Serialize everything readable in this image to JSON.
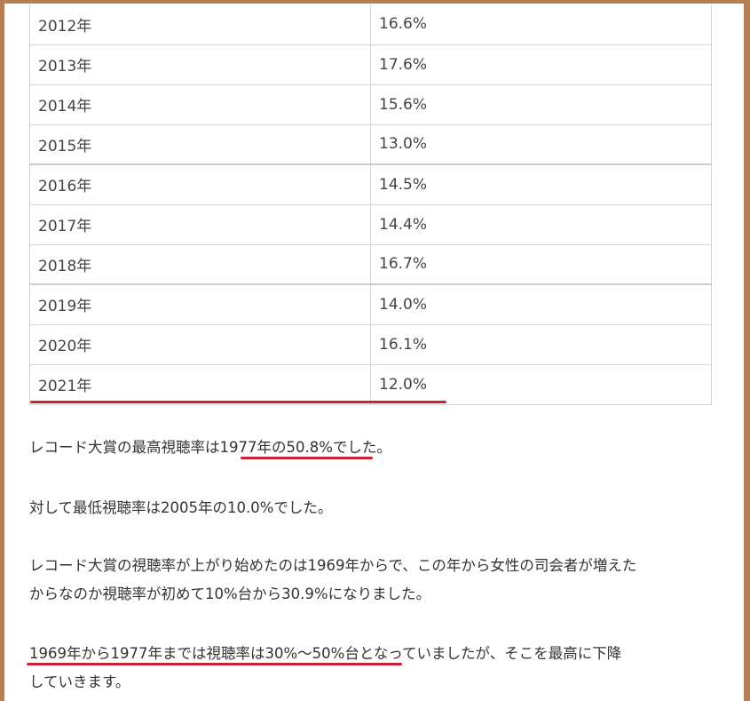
{
  "table": {
    "rows": [
      {
        "year": "2012年",
        "rating": "16.6%"
      },
      {
        "year": "2013年",
        "rating": "17.6%"
      },
      {
        "year": "2014年",
        "rating": "15.6%"
      },
      {
        "year": "2015年",
        "rating": "13.0%"
      },
      {
        "year": "2016年",
        "rating": "14.5%"
      },
      {
        "year": "2017年",
        "rating": "14.4%"
      },
      {
        "year": "2018年",
        "rating": "16.7%"
      },
      {
        "year": "2019年",
        "rating": "14.0%"
      },
      {
        "year": "2020年",
        "rating": "16.1%"
      },
      {
        "year": "2021年",
        "rating": "12.0%"
      }
    ]
  },
  "paragraphs": {
    "p1_before": "レコード大賞の最高視聴率は",
    "p1_highlight": "1977年の50.8%",
    "p1_after": "でした。",
    "p2": "対して最低視聴率は2005年の10.0%でした。",
    "p3_line1": "レコード大賞の視聴率が上がり始めたのは1969年からで、この年から女性の司会者が増えた",
    "p3_line2": "からなのか視聴率が初めて10%台から30.9%になりました。",
    "p4_highlight": "1969年から1977年までは視聴率は30%～50%台",
    "p4_after": "となっていましたが、そこを最高に下降",
    "p4_line2": "していきます。"
  },
  "colors": {
    "frame": "#b47f52",
    "underline": "#cc2233"
  }
}
